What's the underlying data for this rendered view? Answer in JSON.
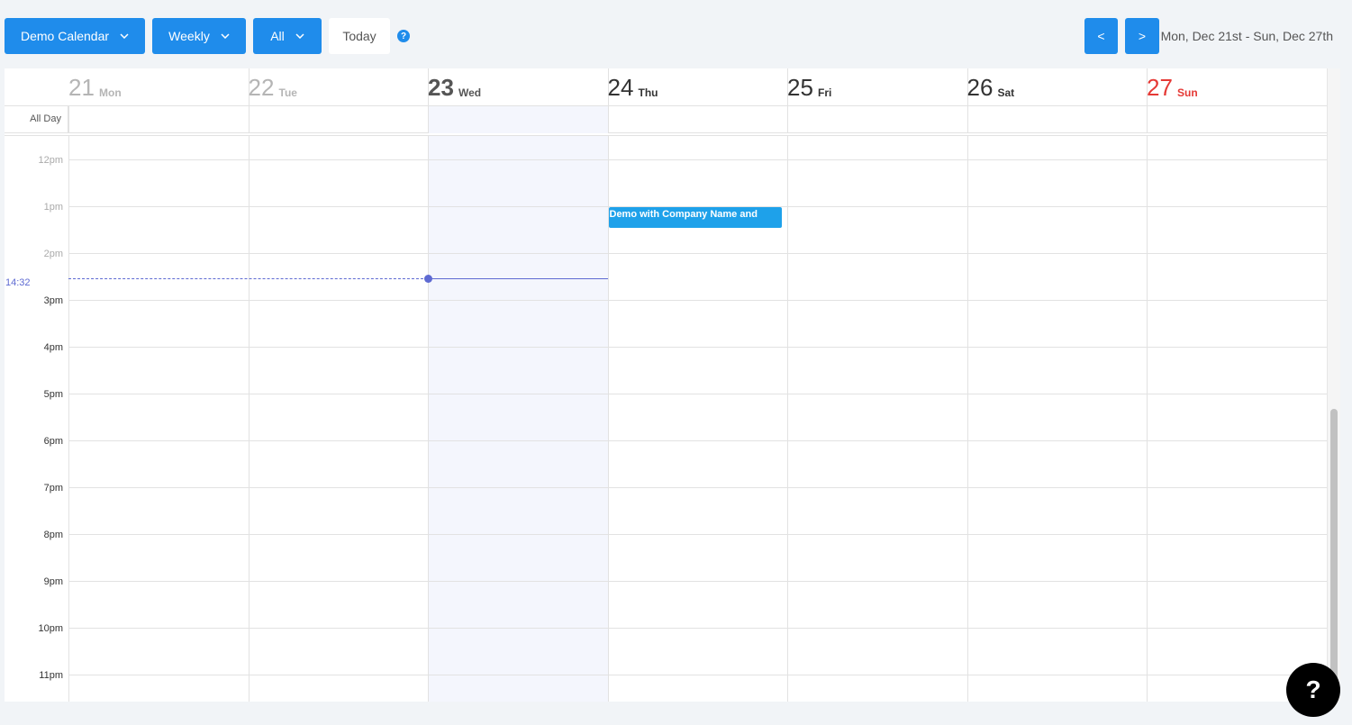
{
  "toolbar": {
    "calendar_label": "Demo Calendar",
    "view_label": "Weekly",
    "filter_label": "All",
    "today_label": "Today",
    "help_symbol": "?",
    "prev_label": "<",
    "next_label": ">",
    "date_range": "Mon, Dec 21st - Sun, Dec 27th"
  },
  "days": [
    {
      "num": "21",
      "dow": "Mon",
      "style": "past"
    },
    {
      "num": "22",
      "dow": "Tue",
      "style": "past"
    },
    {
      "num": "23",
      "dow": "Wed",
      "style": "today"
    },
    {
      "num": "24",
      "dow": "Thu",
      "style": "normal"
    },
    {
      "num": "25",
      "dow": "Fri",
      "style": "normal"
    },
    {
      "num": "26",
      "dow": "Sat",
      "style": "normal"
    },
    {
      "num": "27",
      "dow": "Sun",
      "style": "weekend"
    }
  ],
  "all_day_label": "All Day",
  "hours": [
    "12pm",
    "1pm",
    "2pm",
    "3pm",
    "4pm",
    "5pm",
    "6pm",
    "7pm",
    "8pm",
    "9pm",
    "10pm",
    "11pm"
  ],
  "past_hours": [
    "12pm",
    "1pm",
    "2pm"
  ],
  "now_time": "14:32",
  "event": {
    "title": "Demo with Company Name and",
    "day_index": 3
  },
  "help_fab_symbol": "?",
  "colors": {
    "accent": "#1f8ceb",
    "event": "#1ea1ea",
    "now": "#5e6ad2",
    "weekend": "#e53935",
    "today_bg": "#f4f6fd"
  }
}
